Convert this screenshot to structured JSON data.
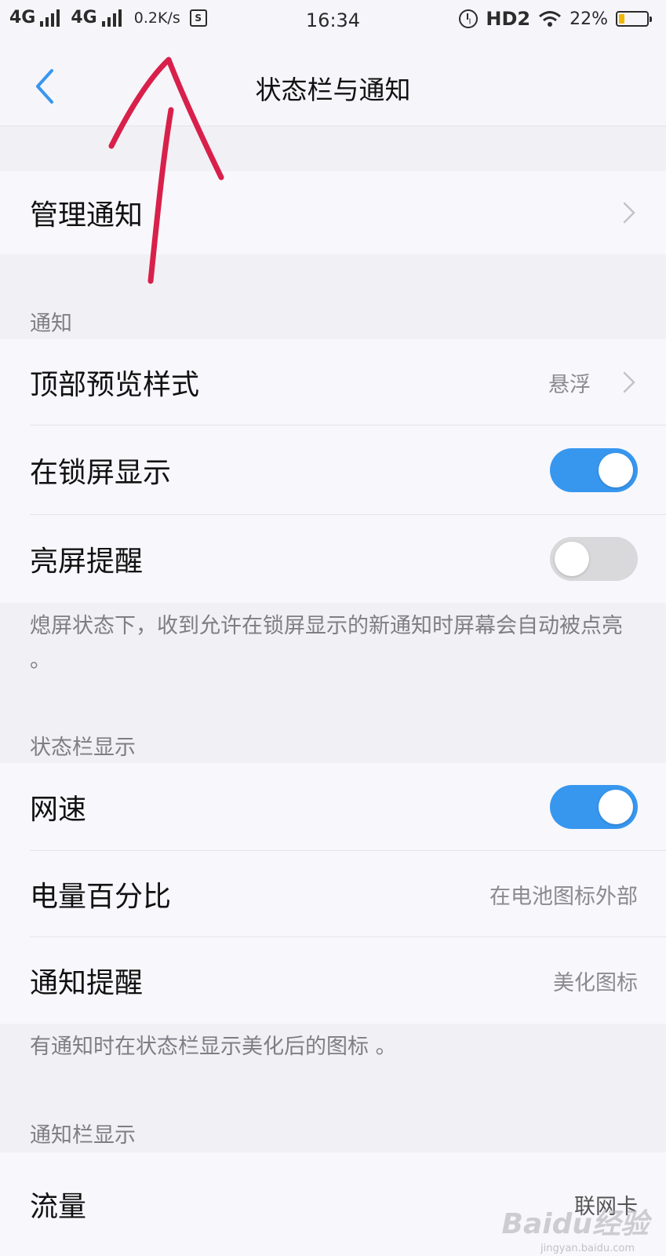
{
  "status_bar": {
    "net1": "4G",
    "net2": "4G",
    "speed": "0.2K/s",
    "sim_icon": "S",
    "time": "16:34",
    "hd": "HD2",
    "battery": "22%",
    "battery_level": 0.22,
    "battery_color": "#f2b705"
  },
  "header": {
    "title": "状态栏与通知"
  },
  "rows": {
    "manage": {
      "label": "管理通知"
    },
    "preview": {
      "label": "顶部预览样式",
      "value": "悬浮"
    },
    "lockscreen": {
      "label": "在锁屏显示",
      "state": "on"
    },
    "wake": {
      "label": "亮屏提醒",
      "state": "off"
    },
    "netspeed": {
      "label": "网速",
      "state": "on"
    },
    "battery_pct": {
      "label": "电量百分比",
      "value": "在电池图标外部"
    },
    "notify_remind": {
      "label": "通知提醒",
      "value": "美化图标"
    },
    "traffic": {
      "label": "流量",
      "value": "联网卡"
    }
  },
  "sections": {
    "notify": "通知",
    "statusbar": "状态栏显示",
    "notifybar": "通知栏显示"
  },
  "notes": {
    "wake_note": "熄屏状态下，收到允许在锁屏显示的新通知时屏幕会自动被点亮 。",
    "icon_note": "有通知时在状态栏显示美化后的图标 。"
  },
  "watermark": {
    "brand": "Baidu经验",
    "url": "jingyan.baidu.com"
  },
  "colors": {
    "accent": "#3797ef",
    "annotation": "#d8204a"
  }
}
